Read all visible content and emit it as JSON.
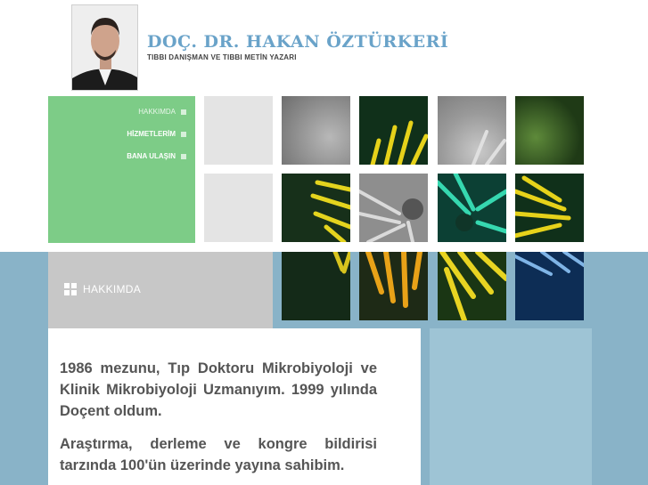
{
  "header": {
    "title": "DOÇ. DR. HAKAN ÖZTÜRKERİ",
    "subtitle": "TIBBI DANIŞMAN VE TIBBI METİN YAZARI"
  },
  "nav": {
    "items": [
      {
        "label": "HAKKIMDA",
        "active": true
      },
      {
        "label": "HİZMETLERİM",
        "active": false
      },
      {
        "label": "BANA ULAŞIN",
        "active": false
      }
    ]
  },
  "section": {
    "label": "HAKKIMDA"
  },
  "content": {
    "paragraphs": [
      "1986 mezunu, Tıp Doktoru Mikrobiyoloji ve Klinik Mikrobiyoloji Uzmanıyım. 1999 yılında Doçent oldum.",
      "Araştırma, derleme ve kongre bildirisi tarzında 100'ün üzerinde yayına sahibim."
    ]
  },
  "colors": {
    "accent_green": "#7dcc87",
    "accent_blue": "#89b3c8",
    "title_blue": "#6aa3c9"
  }
}
